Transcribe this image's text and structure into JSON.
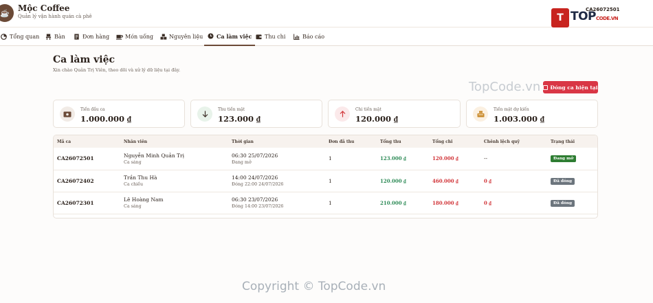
{
  "header": {
    "app_name": "Mộc Coffee",
    "app_subtitle": "Quản lý vận hành quán cà phê",
    "current_shift_code": "CA26072501"
  },
  "watermark": {
    "logo_glyph": "T",
    "brand_top": "TOP",
    "brand_code": "CODE.VN",
    "mid_text": "TopCode.vn",
    "copyright": "Copyright © TopCode.vn"
  },
  "nav": {
    "items": [
      {
        "label": "Tổng quan",
        "icon": "pie-chart-icon"
      },
      {
        "label": "Bàn",
        "icon": "chair-icon"
      },
      {
        "label": "Đơn hàng",
        "icon": "receipt-icon"
      },
      {
        "label": "Món uống",
        "icon": "cup-icon"
      },
      {
        "label": "Nguyên liệu",
        "icon": "boxes-icon"
      },
      {
        "label": "Ca làm việc",
        "icon": "clock-icon",
        "active": true
      },
      {
        "label": "Thu chi",
        "icon": "wallet-icon"
      },
      {
        "label": "Báo cáo",
        "icon": "bar-chart-icon"
      }
    ]
  },
  "page": {
    "title": "Ca làm việc",
    "subtitle": "Xin chào Quản Trị Viên, theo dõi và xử lý dữ liệu tại đây.",
    "close_shift_label": "Đóng ca hiện tại"
  },
  "summary": [
    {
      "label": "Tiền đầu ca",
      "value": "1.000.000 ₫",
      "icon": "cash-icon",
      "icon_bg": "#f1ebe6",
      "icon_color": "#6b4a37"
    },
    {
      "label": "Thu tiền mặt",
      "value": "123.000 ₫",
      "icon": "arrow-down-icon",
      "icon_bg": "#e8f3ea",
      "icon_color": "#2e8b57"
    },
    {
      "label": "Chi tiền mặt",
      "value": "120.000 ₫",
      "icon": "arrow-up-icon",
      "icon_bg": "#fbe9ea",
      "icon_color": "#d13438"
    },
    {
      "label": "Tiền mặt dự kiến",
      "value": "1.003.000 ₫",
      "icon": "register-icon",
      "icon_bg": "#fbf0e1",
      "icon_color": "#c98a2b"
    }
  ],
  "table": {
    "headers": [
      "Mã ca",
      "Nhân viên",
      "Thời gian",
      "Đơn đã thu",
      "Tổng thu",
      "Tổng chi",
      "Chênh lệch quỹ",
      "Trạng thái"
    ],
    "rows": [
      {
        "code": "CA26072501",
        "staff": "Nguyễn Minh Quản Trị",
        "shift": "Ca sáng",
        "time": "06:30 25/07/2026",
        "time_sub": "Đang mở",
        "orders": "1",
        "income": "123.000 ₫",
        "expense": "120.000 ₫",
        "diff": "--",
        "status": "Đang mở",
        "status_type": "open"
      },
      {
        "code": "CA26072402",
        "staff": "Trần Thu Hà",
        "shift": "Ca chiều",
        "time": "14:00 24/07/2026",
        "time_sub": "Đóng 22:00 24/07/2026",
        "orders": "1",
        "income": "120.000 ₫",
        "expense": "460.000 ₫",
        "diff": "0 ₫",
        "status": "Đã đóng",
        "status_type": "closed"
      },
      {
        "code": "CA26072301",
        "staff": "Lê Hoàng Nam",
        "shift": "Ca sáng",
        "time": "06:30 23/07/2026",
        "time_sub": "Đóng 14:00 23/07/2026",
        "orders": "1",
        "income": "210.000 ₫",
        "expense": "180.000 ₫",
        "diff": "0 ₫",
        "status": "Đã đóng",
        "status_type": "closed"
      }
    ]
  }
}
